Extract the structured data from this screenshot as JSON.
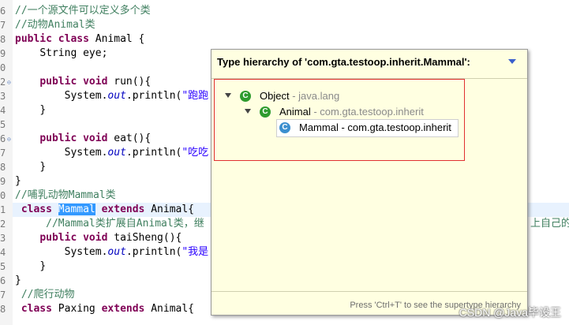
{
  "editor": {
    "lines": [
      {
        "num": "6",
        "text": "//一个源文件可以定义多个类"
      },
      {
        "num": "7",
        "text": "//动物Animal类"
      },
      {
        "num": "8",
        "kw1": "public",
        "kw2": "class",
        "rest": " Animal {"
      },
      {
        "num": "9",
        "indent": "    ",
        "text": "String eye;"
      },
      {
        "num": "0",
        "text": ""
      },
      {
        "num": "2",
        "indent": "    ",
        "kw1": "public",
        "kw2": "void",
        "rest": " run(){"
      },
      {
        "num": "3",
        "indent": "        ",
        "pre": "System.",
        "field": "out",
        "mid": ".println(",
        "str": "\"跑跑"
      },
      {
        "num": "4",
        "indent": "    ",
        "text": "}"
      },
      {
        "num": "5",
        "text": ""
      },
      {
        "num": "6",
        "indent": "    ",
        "kw1": "public",
        "kw2": "void",
        "rest": " eat(){"
      },
      {
        "num": "7",
        "indent": "        ",
        "pre": "System.",
        "field": "out",
        "mid": ".println(",
        "str": "\"吃吃"
      },
      {
        "num": "8",
        "indent": "    ",
        "text": "}"
      },
      {
        "num": "9",
        "text": "}"
      },
      {
        "num": "0",
        "text": "//哺乳动物Mammal类"
      },
      {
        "num": "1",
        "indent": " ",
        "kw2": "class",
        "sel": "Mammal",
        "kw3": "extends",
        "rest": " Animal{"
      },
      {
        "num": "2",
        "indent": "     ",
        "text": "//Mammal类扩展自Animal类，继",
        "tail": "上自己的"
      },
      {
        "num": "3",
        "indent": "    ",
        "kw1": "public",
        "kw2": "void",
        "rest": " taiSheng(){"
      },
      {
        "num": "4",
        "indent": "        ",
        "pre": "System.",
        "field": "out",
        "mid": ".println(",
        "str": "\"我是"
      },
      {
        "num": "5",
        "indent": "    ",
        "text": "}"
      },
      {
        "num": "6",
        "text": "}"
      },
      {
        "num": "7",
        "indent": " ",
        "text": "//爬行动物"
      },
      {
        "num": "8",
        "indent": " ",
        "kw2": "class",
        "rest": " Paxing ",
        "kw3": "extends",
        "rest2": " Animal{"
      }
    ]
  },
  "popup": {
    "title": "Type hierarchy of 'com.gta.testoop.inherit.Mammal':",
    "menu_icon": "triangle-down-icon",
    "tree": [
      {
        "name": "Object",
        "pkg": " - java.lang"
      },
      {
        "name": "Animal",
        "pkg": " - com.gta.testoop.inherit"
      },
      {
        "name": "Mammal - com.gta.testoop.inherit",
        "pkg": ""
      }
    ],
    "status": "Press 'Ctrl+T' to see the supertype hierarchy"
  },
  "watermark": "CSDN @Java毕设王",
  "colors": {
    "keyword": "#7f0055",
    "comment": "#3f7f5f",
    "string": "#2a00ff",
    "popup_bg": "#ffffe1",
    "highlight": "#e03030"
  }
}
